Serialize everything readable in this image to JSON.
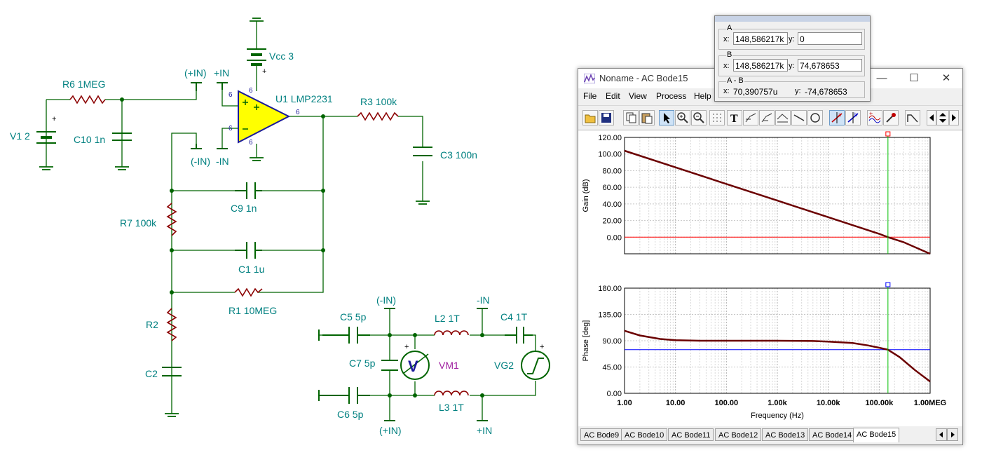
{
  "schematic": {
    "labels": {
      "v1": "V1 2",
      "r6": "R6 1MEG",
      "c10": "C10 1n",
      "plus_in_paren": "(+IN)",
      "plus_in": "+IN",
      "minus_in_paren": "(-IN)",
      "minus_in": "-IN",
      "vcc": "Vcc 3",
      "u1": "U1 LMP2231",
      "r3": "R3 100k",
      "c3": "C3 100n",
      "c9": "C9 1n",
      "r7": "R7 100k",
      "c1": "C1 1u",
      "r1": "R1 10MEG",
      "r2": "R2",
      "c2": "C2",
      "c5": "C5 5p",
      "c7": "C7 5p",
      "c6": "C6 5p",
      "l2": "L2 1T",
      "l3": "L3 1T",
      "c4": "C4 1T",
      "vm1": "VM1",
      "vg2": "VG2",
      "bot_minus_in_paren": "(-IN)",
      "bot_minus_in": "-IN",
      "bot_plus_in_paren": "(+IN)",
      "bot_plus_in": "+IN",
      "pin6a": "6",
      "pin6b": "6",
      "pin6c": "6",
      "pin6d": "6",
      "pin6e": "6",
      "plus_sign": "+",
      "vm_plus": "+",
      "vg_plus": "+"
    },
    "colors": {
      "wire": "#006400",
      "component": "#8b0000",
      "label": "#008080",
      "opamp_fill": "#ffff00"
    }
  },
  "cursor_window": {
    "group_a": {
      "title": "A",
      "x_label": "x:",
      "x_value": "148,586217k",
      "y_label": "y:",
      "y_value": "0"
    },
    "group_b": {
      "title": "B",
      "x_label": "x:",
      "x_value": "148,586217k",
      "y_label": "y:",
      "y_value": "74,678653"
    },
    "group_ab": {
      "title": "A - B",
      "x_label": "x:",
      "x_value": "70,390757u",
      "y_label": "y:",
      "y_value": "-74,678653"
    }
  },
  "window": {
    "title": "Noname - AC Bode15",
    "buttons": {
      "minimize": "—",
      "maximize": "☐",
      "close": "✕"
    },
    "menu": [
      "File",
      "Edit",
      "View",
      "Process",
      "Help"
    ],
    "toolbar_icons": [
      "open-icon",
      "save-icon",
      "copy-icon",
      "paste-icon",
      "pointer-icon",
      "zoom-in-icon",
      "zoom-out-icon",
      "grid-icon",
      "text-icon",
      "curve-label-icon",
      "curve-label2-icon",
      "curve-label3-icon",
      "line-icon",
      "circle-icon",
      "cursor-a-icon",
      "cursor-b-icon",
      "add-curve-icon",
      "eyedropper-icon",
      "marker-icon",
      "step-left-icon",
      "step-updown-icon",
      "step-right-icon"
    ],
    "tabs": [
      "AC Bode9",
      "AC Bode10",
      "AC Bode11",
      "AC Bode12",
      "AC Bode13",
      "AC Bode14",
      "AC Bode15"
    ],
    "active_tab": "AC Bode15"
  },
  "chart_data": [
    {
      "type": "line",
      "ylabel": "Gain (dB)",
      "xlabel": "",
      "xscale": "log",
      "xlim": [
        1,
        1000000
      ],
      "ylim": [
        -20,
        120
      ],
      "yticks": [
        "120.00",
        "100.00",
        "80.00",
        "60.00",
        "40.00",
        "20.00",
        "0.00"
      ],
      "series": [
        {
          "color": "#6b0000",
          "x": [
            1,
            10,
            100,
            1000,
            10000,
            100000,
            148586,
            300000,
            1000000
          ],
          "y": [
            104,
            84,
            64,
            44,
            24,
            4,
            0,
            -6,
            -20
          ]
        }
      ],
      "cursor": {
        "x": 148586.217,
        "y": 0,
        "color": "#ff0000"
      },
      "grid": true
    },
    {
      "type": "line",
      "ylabel": "Phase [deg]",
      "xlabel": "Frequency (Hz)",
      "xscale": "log",
      "xlim": [
        1,
        1000000
      ],
      "ylim": [
        0,
        180
      ],
      "yticks": [
        "180.00",
        "135.00",
        "90.00",
        "45.00",
        "0.00"
      ],
      "xticks": [
        "1.00",
        "10.00",
        "100.00",
        "1.00k",
        "10.00k",
        "100.00k",
        "1.00MEG"
      ],
      "series": [
        {
          "color": "#6b0000",
          "x": [
            1,
            2,
            5,
            10,
            30,
            100,
            1000,
            5000,
            10000,
            30000,
            60000,
            100000,
            148586,
            250000,
            500000,
            1000000
          ],
          "y": [
            107,
            99,
            93,
            91,
            90,
            90,
            90,
            89.5,
            88.5,
            86,
            82,
            78,
            74.7,
            62,
            40,
            20
          ]
        }
      ],
      "cursor": {
        "x": 148586.217,
        "y": 74.678653,
        "color": "#0000ff"
      },
      "grid": true
    }
  ]
}
